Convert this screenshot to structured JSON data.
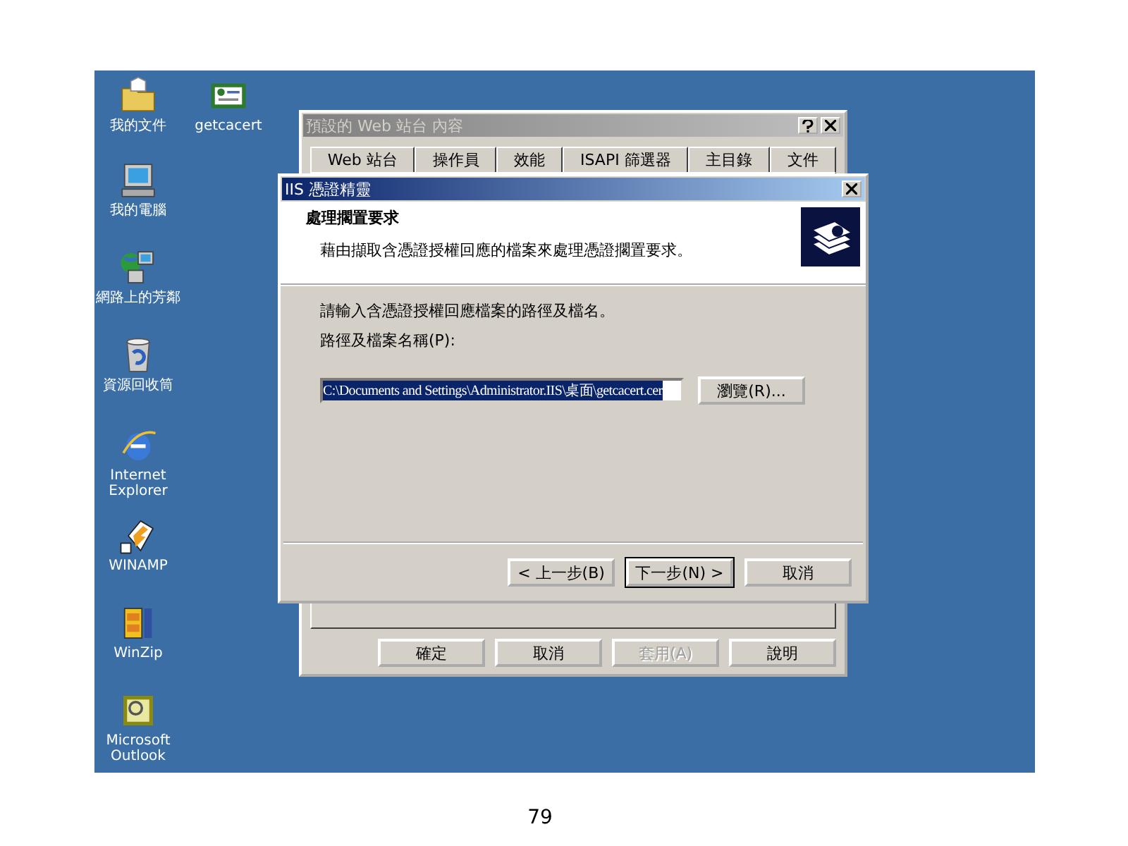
{
  "desktop": {
    "icons": [
      {
        "label": "我的文件",
        "kind": "folder"
      },
      {
        "label": "getcacert",
        "kind": "certificate"
      },
      {
        "label": "我的電腦",
        "kind": "computer"
      },
      {
        "label": "網路上的芳鄰",
        "kind": "network"
      },
      {
        "label": "資源回收筒",
        "kind": "recycle"
      },
      {
        "label": "Internet Explorer",
        "kind": "browser"
      },
      {
        "label": "WINAMP",
        "kind": "player"
      },
      {
        "label": "WinZip",
        "kind": "archive"
      },
      {
        "label": "Microsoft Outlook",
        "kind": "mail"
      }
    ]
  },
  "properties_window": {
    "title": "預設的 Web 站台 內容",
    "tabs": [
      {
        "label": "Web 站台"
      },
      {
        "label": "操作員"
      },
      {
        "label": "效能"
      },
      {
        "label": "ISAPI 篩選器"
      },
      {
        "label": "主目錄"
      },
      {
        "label": "文件"
      }
    ],
    "buttons": [
      {
        "label": "確定",
        "disabled": false
      },
      {
        "label": "取消",
        "disabled": false
      },
      {
        "label": "套用(A)",
        "disabled": true
      },
      {
        "label": "說明",
        "disabled": false
      }
    ]
  },
  "wizard": {
    "title": "IIS 憑證精靈",
    "heading": "處理擱置要求",
    "subheading": "藉由擷取含憑證授權回應的檔案來處理憑證擱置要求。",
    "instruction": "請輸入含憑證授權回應檔案的路徑及檔名。",
    "path_label": "路徑及檔案名稱(P):",
    "path_value": "C:\\Documents and Settings\\Administrator.IIS\\桌面\\getcacert.cer",
    "browse_button": "瀏覽(R)...",
    "buttons": [
      {
        "label": "< 上一步(B)",
        "default": false
      },
      {
        "label": "下一步(N) >",
        "default": true
      },
      {
        "label": "取消",
        "default": false
      }
    ]
  },
  "page_number": "79"
}
